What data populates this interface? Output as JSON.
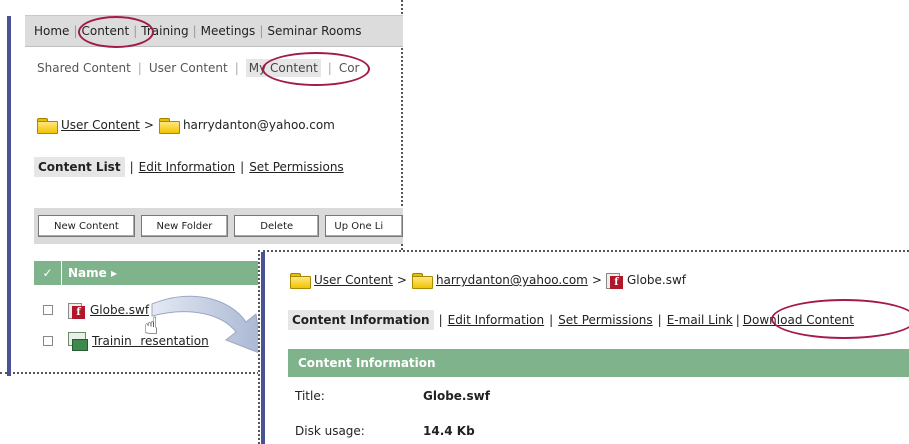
{
  "top_nav": {
    "items": [
      "Home",
      "Content",
      "Training",
      "Meetings",
      "Seminar Rooms"
    ]
  },
  "sub_nav": {
    "items": [
      "Shared Content",
      "User Content",
      "My Content",
      "Cor"
    ]
  },
  "panel1": {
    "breadcrumb": {
      "root": "User Content",
      "separator": ">",
      "folder": "harrydanton@yahoo.com"
    },
    "tabs": {
      "current": "Content List",
      "links": [
        "Edit Information",
        "Set Permissions"
      ],
      "separator": "|"
    },
    "toolbar": {
      "new_content": "New Content",
      "new_folder": "New Folder",
      "delete": "Delete",
      "up_one_level": "Up One Li"
    },
    "grid": {
      "check_header": "✓",
      "name_header": "Name ▸",
      "rows": [
        {
          "name": "Globe.swf",
          "icon": "swf-file-icon"
        },
        {
          "name": "Trainin   resentation",
          "icon": "presentation-icon"
        }
      ]
    }
  },
  "panel2": {
    "breadcrumb": {
      "root": "User Content",
      "separator": ">",
      "folder": "harrydanton@yahoo.com",
      "file": "Globe.swf"
    },
    "tabs": {
      "current": "Content Information",
      "links": [
        "Edit Information",
        "Set Permissions",
        "E-mail Link",
        "Download Content"
      ],
      "separator": "|"
    },
    "info_header": "Content Information",
    "fields": [
      {
        "label": "Title:",
        "value": "Globe.swf"
      },
      {
        "label": "Disk usage:",
        "value": "14.4 Kb"
      }
    ]
  },
  "colors": {
    "accent_green": "#7fb38c",
    "highlight_ellipse": "#a41a4b",
    "left_bar": "#4a5294"
  }
}
